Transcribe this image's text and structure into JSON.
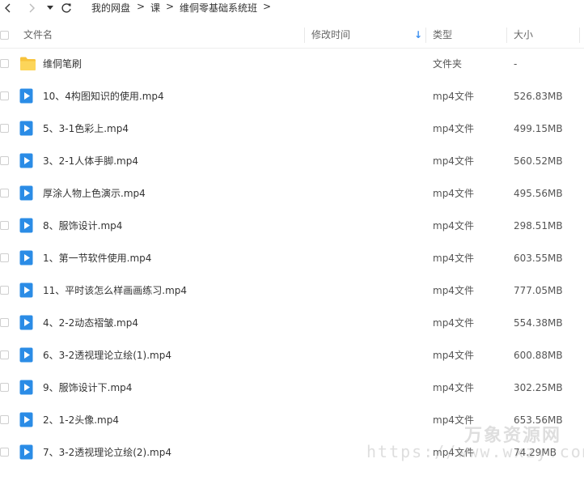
{
  "breadcrumb": {
    "items": [
      "我的网盘",
      "课",
      "维侗零基础系统班"
    ],
    "separator": ">"
  },
  "columns": {
    "name": "文件名",
    "modified": "修改时间",
    "type": "类型",
    "size": "大小",
    "sort_indicator": "↓"
  },
  "rows": [
    {
      "name": "维侗笔刷",
      "type": "文件夹",
      "size": "-",
      "kind": "folder"
    },
    {
      "name": "10、4构图知识的使用.mp4",
      "type": "mp4文件",
      "size": "526.83MB",
      "kind": "video"
    },
    {
      "name": "5、3-1色彩上.mp4",
      "type": "mp4文件",
      "size": "499.15MB",
      "kind": "video"
    },
    {
      "name": "3、2-1人体手脚.mp4",
      "type": "mp4文件",
      "size": "560.52MB",
      "kind": "video"
    },
    {
      "name": "厚涂人物上色演示.mp4",
      "type": "mp4文件",
      "size": "495.56MB",
      "kind": "video"
    },
    {
      "name": "8、服饰设计.mp4",
      "type": "mp4文件",
      "size": "298.51MB",
      "kind": "video"
    },
    {
      "name": "1、第一节软件使用.mp4",
      "type": "mp4文件",
      "size": "603.55MB",
      "kind": "video"
    },
    {
      "name": "11、平时该怎么样画画练习.mp4",
      "type": "mp4文件",
      "size": "777.05MB",
      "kind": "video"
    },
    {
      "name": "4、2-2动态褶皱.mp4",
      "type": "mp4文件",
      "size": "554.38MB",
      "kind": "video"
    },
    {
      "name": "6、3-2透视理论立绘(1).mp4",
      "type": "mp4文件",
      "size": "600.88MB",
      "kind": "video"
    },
    {
      "name": "9、服饰设计下.mp4",
      "type": "mp4文件",
      "size": "302.25MB",
      "kind": "video"
    },
    {
      "name": "2、1-2头像.mp4",
      "type": "mp4文件",
      "size": "653.56MB",
      "kind": "video"
    },
    {
      "name": "7、3-2透视理论立绘(2).mp4",
      "type": "mp4文件",
      "size": "74.29MB",
      "kind": "video"
    }
  ],
  "watermark": {
    "brand": "万象资源网",
    "url": "https://www.wxzy.com"
  },
  "colors": {
    "video_icon": "#2b8ce6",
    "folder_icon": "#f7c33c",
    "sort_arrow": "#3b8ff0"
  }
}
